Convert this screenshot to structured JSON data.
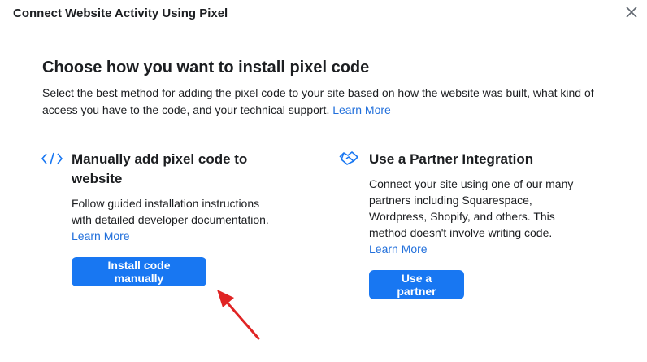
{
  "header": {
    "title": "Connect Website Activity Using Pixel"
  },
  "main": {
    "heading": "Choose how you want to install pixel code",
    "description": "Select the best method for adding the pixel code to your site based on how the website was built, what kind of access you have to the code, and your technical support.",
    "learn_more": "Learn More"
  },
  "options": [
    {
      "icon": "code-icon",
      "title_line1": "Manually add pixel code to",
      "title_line2": "website",
      "description": "Follow guided installation instructions with detailed developer documentation.",
      "learn_more": "Learn More",
      "button_label": "Install code manually"
    },
    {
      "icon": "handshake-icon",
      "title": "Use a Partner Integration",
      "description": "Connect your site using one of our many partners including Squarespace, Wordpress, Shopify, and others. This method doesn't involve writing code.",
      "learn_more": "Learn More",
      "button_label": "Use a partner"
    }
  ],
  "colors": {
    "accent": "#1877f2",
    "link": "#216fdb",
    "arrow": "#e02424"
  }
}
